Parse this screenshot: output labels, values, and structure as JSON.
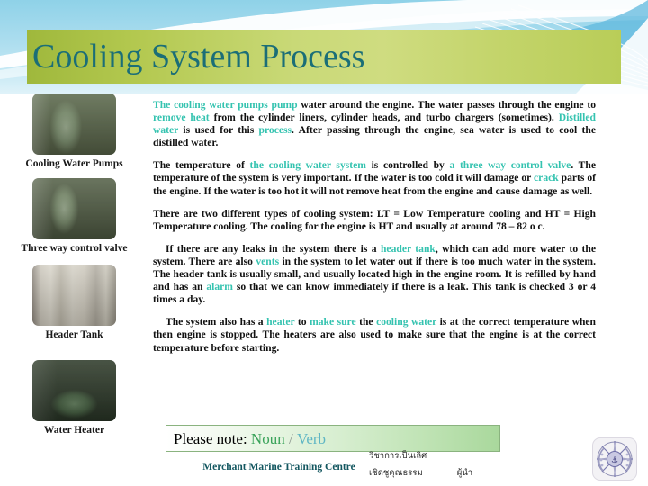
{
  "slide": {
    "title": "Cooling System Process",
    "title_color": "#1b6e77",
    "title_band_color": "#c3d46a",
    "header_bg_color": "#a9dcee",
    "highlight_color": "#35c3b0"
  },
  "photos": [
    {
      "caption": "Cooling Water Pumps",
      "image_name": "cooling-water-pumps-photo"
    },
    {
      "caption": "Three way control valve",
      "image_name": "three-way-control-valve-photo"
    },
    {
      "caption": "Header Tank",
      "image_name": "header-tank-photo"
    },
    {
      "caption": "Water Heater",
      "image_name": "water-heater-photo"
    }
  ],
  "paragraphs": [
    {
      "id": "p1",
      "indent": false,
      "runs": [
        {
          "t": "The cooling water pumps pump",
          "hl": true
        },
        {
          "t": " water  around the engine. The water passes through the engine to ",
          "hl": false
        },
        {
          "t": "remove heat",
          "hl": true
        },
        {
          "t": " from the cylinder liners, cylinder heads, and turbo chargers (sometimes). ",
          "hl": false
        },
        {
          "t": "Distilled water",
          "hl": true
        },
        {
          "t": " is used for this ",
          "hl": false
        },
        {
          "t": "process",
          "hl": true
        },
        {
          "t": ". After passing through the engine, sea water is used to cool the distilled water.",
          "hl": false
        }
      ]
    },
    {
      "id": "p2",
      "indent": false,
      "runs": [
        {
          "t": "The temperature of ",
          "hl": false
        },
        {
          "t": "the cooling water system",
          "hl": true
        },
        {
          "t": " is controlled by ",
          "hl": false
        },
        {
          "t": "a three way control valve",
          "hl": true
        },
        {
          "t": ". The temperature of the system is very important. If the water is too cold it will damage or ",
          "hl": false
        },
        {
          "t": "crack",
          "hl": true
        },
        {
          "t": " parts of the engine. If the water is too hot it will not remove heat from the engine and cause damage as well.",
          "hl": false
        }
      ]
    },
    {
      "id": "p3",
      "indent": false,
      "runs": [
        {
          "t": "There are two different types of cooling system: LT = Low Temperature cooling and HT = High Temperature cooling. The cooling for the engine is HT and usually at around 78 – 82 o c.",
          "hl": false
        }
      ]
    },
    {
      "id": "p4",
      "indent": true,
      "runs": [
        {
          "t": "If there are any leaks in the system there is a ",
          "hl": false
        },
        {
          "t": "header tank",
          "hl": true
        },
        {
          "t": ", which can add more water to the system. There are also ",
          "hl": false
        },
        {
          "t": "vents",
          "hl": true
        },
        {
          "t": "  in the system to let water out if there is too much water in the system. The header tank is usually small, and usually located high in the engine room. It is refilled by hand and has an ",
          "hl": false
        },
        {
          "t": "alarm",
          "hl": true
        },
        {
          "t": " so that we can know immediately if there is a leak. This tank is checked 3 or 4 times a day.",
          "hl": false
        }
      ]
    },
    {
      "id": "p5",
      "indent": true,
      "runs": [
        {
          "t": "The system also has a ",
          "hl": false
        },
        {
          "t": "heater",
          "hl": true
        },
        {
          "t": " to ",
          "hl": false
        },
        {
          "t": "make sure",
          "hl": true
        },
        {
          "t": " the ",
          "hl": false
        },
        {
          "t": "cooling water",
          "hl": true
        },
        {
          "t": "  is at the correct temperature when then engine is stopped. The heaters are also used to make sure that the engine is at the correct temperature before starting.",
          "hl": false
        }
      ]
    }
  ],
  "note": {
    "label": "Please note:",
    "noun": "Noun",
    "separator": "/",
    "verb": "Verb",
    "noun_color": "#3aa35a",
    "verb_color": "#5fb6c4"
  },
  "footer": {
    "organization": "Merchant Marine Training Centre",
    "organization_color": "#12565f",
    "thai_line1": "วิชาการเป็นเลิศ",
    "thai_line2a": "เชิดชูคุณธรรม",
    "thai_line2b": "ผู้นำ",
    "logo_name": "mmtc-emblem-logo"
  }
}
